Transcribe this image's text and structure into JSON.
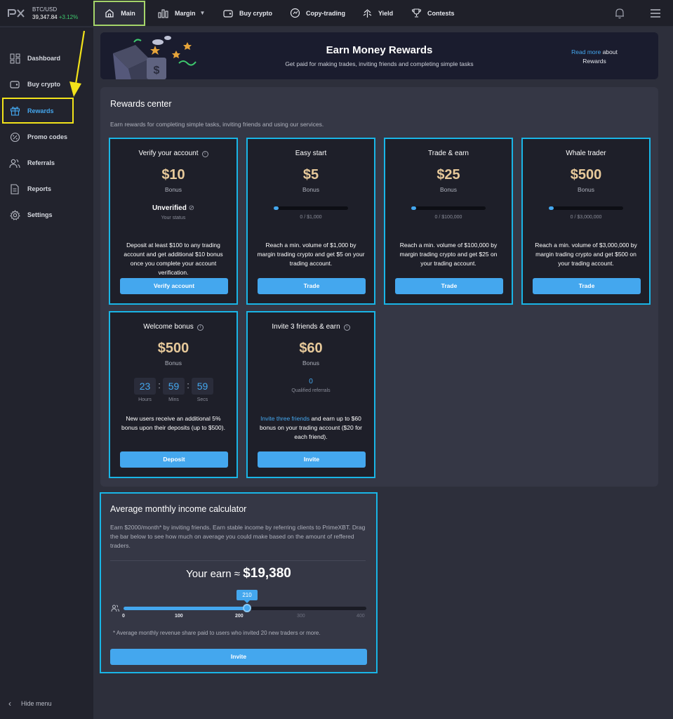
{
  "ticker": {
    "pair": "BTC/USD",
    "price": "39,347.84",
    "change": "+3.12%"
  },
  "topnav": {
    "main": "Main",
    "margin": "Margin",
    "buy_crypto": "Buy crypto",
    "copy_trading": "Copy-trading",
    "yield": "Yield",
    "contests": "Contests"
  },
  "sidebar": {
    "items": [
      {
        "label": "Dashboard",
        "icon": "dashboard-icon"
      },
      {
        "label": "Buy crypto",
        "icon": "wallet-icon"
      },
      {
        "label": "Rewards",
        "icon": "gift-icon"
      },
      {
        "label": "Promo codes",
        "icon": "percent-icon"
      },
      {
        "label": "Referrals",
        "icon": "users-icon"
      },
      {
        "label": "Reports",
        "icon": "document-icon"
      },
      {
        "label": "Settings",
        "icon": "gear-icon"
      }
    ],
    "hide_menu": "Hide menu"
  },
  "banner": {
    "title": "Earn Money Rewards",
    "subtitle": "Get paid for making trades, inviting friends and completing simple tasks",
    "read_more_link": "Read more",
    "read_more_rest": "about",
    "read_more_line2": "Rewards"
  },
  "rewards_center": {
    "title": "Rewards center",
    "subtitle": "Earn rewards for completing simple tasks, inviting friends and using our services.",
    "cards": {
      "verify": {
        "title": "Verify your account",
        "amount": "$10",
        "bonus": "Bonus",
        "status": "Unverified",
        "status_sub": "Your status",
        "desc": "Deposit at least $100 to any trading account and get additional $10 bonus once you complete your account verification.",
        "button": "Verify account"
      },
      "easy": {
        "title": "Easy start",
        "amount": "$5",
        "bonus": "Bonus",
        "progress_label": "0 / $1,000",
        "desc": "Reach a min. volume of $1,000 by margin trading crypto and get $5 on your trading account.",
        "button": "Trade"
      },
      "trade": {
        "title": "Trade & earn",
        "amount": "$25",
        "bonus": "Bonus",
        "progress_label": "0 / $100,000",
        "desc": "Reach a min. volume of $100,000 by margin trading crypto and get $25 on your trading account.",
        "button": "Trade"
      },
      "whale": {
        "title": "Whale trader",
        "amount": "$500",
        "bonus": "Bonus",
        "progress_label": "0 / $3,000,000",
        "desc": "Reach a min. volume of $3,000,000 by margin trading crypto and get $500 on your trading account.",
        "button": "Trade"
      },
      "welcome": {
        "title": "Welcome bonus",
        "amount": "$500",
        "bonus": "Bonus",
        "hours": "23",
        "mins": "59",
        "secs": "59",
        "hours_label": "Hours",
        "mins_label": "Mins",
        "secs_label": "Secs",
        "desc": "New users receive an additional 5% bonus upon their deposits (up to $500).",
        "button": "Deposit"
      },
      "invite": {
        "title": "Invite 3 friends & earn",
        "amount": "$60",
        "bonus": "Bonus",
        "count": "0",
        "count_label": "Qualified referrals",
        "desc_link": "Invite three friends",
        "desc_rest": " and earn up to $60 bonus on your trading account ($20 for each friend).",
        "button": "Invite"
      }
    }
  },
  "calculator": {
    "title": "Average monthly income calculator",
    "desc": "Earn $2000/month* by inviting friends. Earn stable income by referring clients to PrimeXBT. Drag the bar below to see how much on average you could make based on the amount of reffered traders.",
    "earn_label": "Your earn ≈",
    "earn_value": "$19,380",
    "slider_value": "210",
    "ticks": [
      "0",
      "100",
      "200",
      "300",
      "400"
    ],
    "note": "* Average monthly revenue share paid to users who invited 20 new traders or more.",
    "button": "Invite"
  },
  "colors": {
    "accent": "#44a7ee",
    "gold": "#e7c99a",
    "highlight_cyan": "#19b5e6",
    "highlight_yellow": "#f2e31a",
    "highlight_green": "#a5d56a"
  }
}
